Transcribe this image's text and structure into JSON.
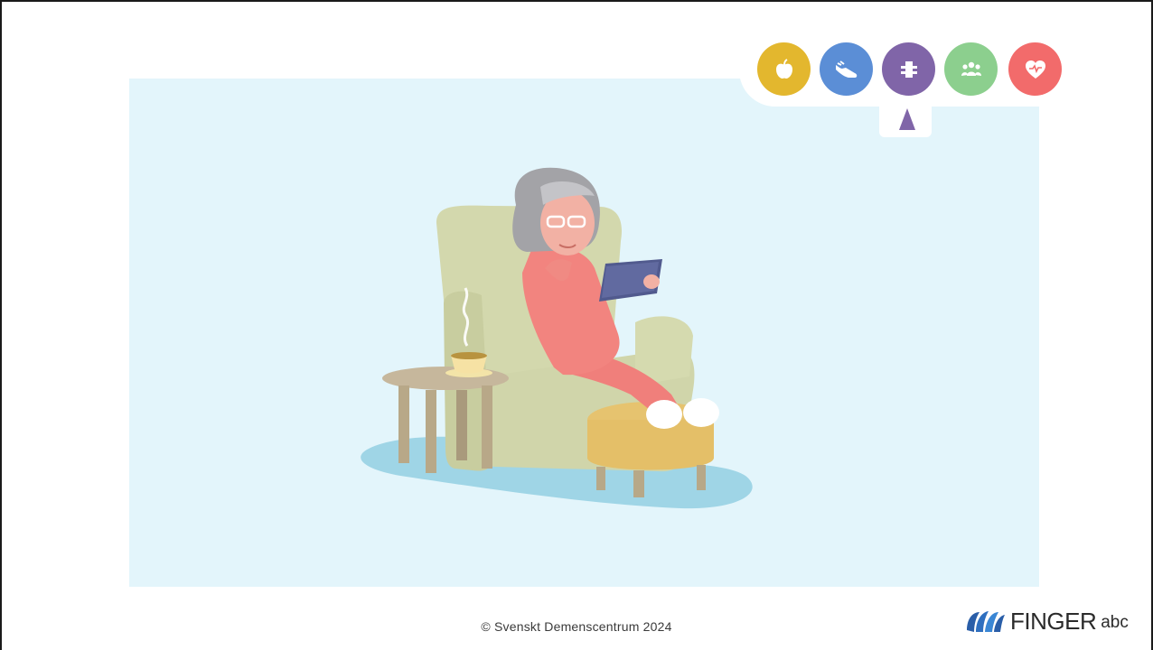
{
  "nav": {
    "categories": [
      {
        "name": "nutrition",
        "icon": "apple-icon",
        "color": "#e3b72e"
      },
      {
        "name": "physical-activity",
        "icon": "shoe-icon",
        "color": "#5b8ed6"
      },
      {
        "name": "cognitive-training",
        "icon": "puzzle-icon",
        "color": "#8065a8",
        "selected": true
      },
      {
        "name": "social-activity",
        "icon": "people-icon",
        "color": "#8ccf8e"
      },
      {
        "name": "heart-health",
        "icon": "heart-pulse-icon",
        "color": "#f26b6b"
      }
    ]
  },
  "colors": {
    "panel_bg": "#e3f5fb",
    "pointer": "#8065a8"
  },
  "footer": {
    "copyright": "© Svenskt Demenscentrum 2024"
  },
  "logo": {
    "text": "FINGER",
    "suffix": "abc",
    "icon": "hands-logo-icon"
  }
}
